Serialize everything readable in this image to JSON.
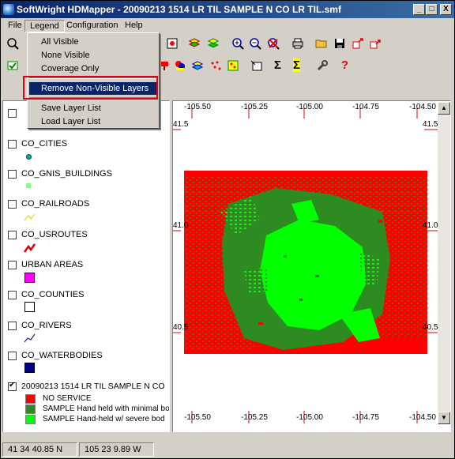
{
  "window": {
    "title": "SoftWright HDMapper - 20090213 1514 LR TIL SAMPLE N CO LR TIL.smf"
  },
  "caption_buttons": {
    "minimize": "_",
    "maximize": "□",
    "close": "X"
  },
  "menubar": [
    {
      "label": "File"
    },
    {
      "label": "Legend"
    },
    {
      "label": "Configuration"
    },
    {
      "label": "Help"
    }
  ],
  "legend_menu": {
    "items": [
      "All Visible",
      "None Visible",
      "Coverage Only"
    ],
    "highlighted": "Remove Non-Visible Layers",
    "items2": [
      "Save Layer List",
      "Load Layer List"
    ]
  },
  "layers": [
    {
      "name": "CO_CITIES",
      "checked": false
    },
    {
      "name": "CO_GNIS_BUILDINGS",
      "checked": false
    },
    {
      "name": "CO_RAILROADS",
      "checked": false
    },
    {
      "name": "CO_USROUTES",
      "checked": false
    },
    {
      "name": "URBAN AREAS",
      "checked": false
    },
    {
      "name": "CO_COUNTIES",
      "checked": false
    },
    {
      "name": "CO_RIVERS",
      "checked": false
    },
    {
      "name": "CO_WATERBODIES",
      "checked": false
    },
    {
      "name": "20090213 1514 LR TIL SAMPLE N CO",
      "checked": true
    }
  ],
  "coverage_legend": [
    {
      "label": "NO SERVICE",
      "color": "#ff0000"
    },
    {
      "label": "SAMPLE Hand held with minimal bo",
      "color": "#2e8b22"
    },
    {
      "label": "SAMPLE Hand-held w/ severe bod",
      "color": "#00ff00"
    }
  ],
  "map": {
    "top_ticks": [
      "-105.50",
      "-105.25",
      "-105.00",
      "-104.75",
      "-104.50"
    ],
    "bottom_ticks": [
      "-105.50",
      "-105.25",
      "-105.00",
      "-104.75",
      "-104.50"
    ],
    "left_ticks": [
      "41.5",
      "41.0",
      "40.5"
    ],
    "right_ticks": [
      "41.5",
      "41.0",
      "40.5"
    ],
    "colors": {
      "no_service": "#ff0000",
      "minimal": "#2e8b22",
      "severe": "#00ff00"
    }
  },
  "status": {
    "lat": "41 34 40.85 N",
    "lon": "105 23 9.89 W"
  },
  "icons": [
    "zoom-in-icon",
    "zoom-out-icon",
    "print-icon",
    "open-icon",
    "save-icon",
    "sigma-icon",
    "wrench-icon",
    "help-icon"
  ]
}
